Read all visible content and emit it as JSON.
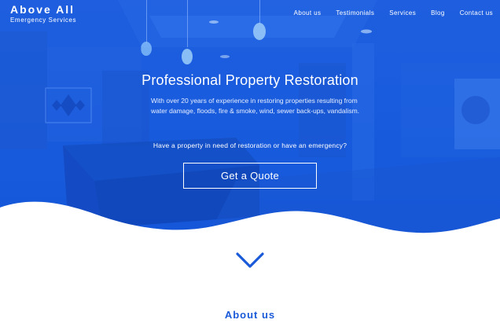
{
  "brand": {
    "title": "Above All",
    "subtitle": "Emergency Services"
  },
  "nav": {
    "items": [
      {
        "label": "About us"
      },
      {
        "label": "Testimonials"
      },
      {
        "label": "Services"
      },
      {
        "label": "Blog"
      },
      {
        "label": "Contact us"
      }
    ]
  },
  "hero": {
    "headline": "Professional Property Restoration",
    "description": "With over 20 years of experience in restoring properties resulting from water damage, floods, fire & smoke, wind, sewer back-ups, vandalism.",
    "question": "Have a property in need of restoration or have an emergency?",
    "cta_label": "Get a Quote",
    "overlay_color": "#1a5cde"
  },
  "scroll_icon": "chevron-down-icon",
  "about": {
    "heading": "About us"
  },
  "colors": {
    "accent": "#1a5ad8",
    "text_on_hero": "#ffffff"
  }
}
